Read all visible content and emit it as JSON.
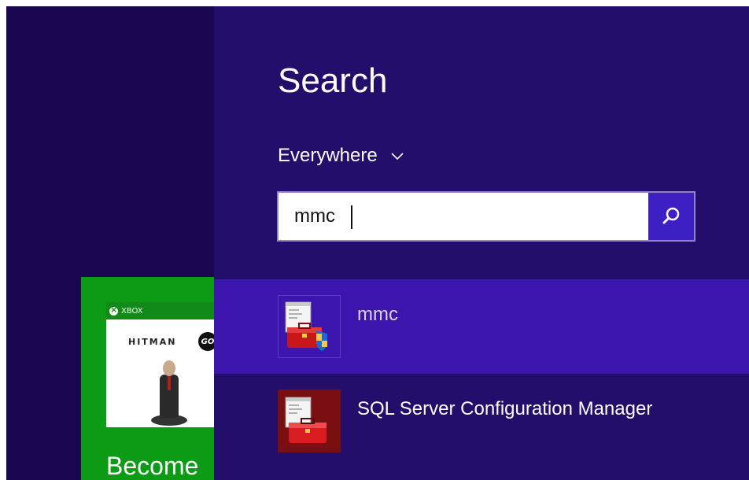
{
  "start_screen": {
    "tile": {
      "brand": "XBOX",
      "game_title": "HITMAN",
      "game_badge": "GO",
      "caption": "Become"
    }
  },
  "search": {
    "title": "Search",
    "scope_label": "Everywhere",
    "query": "mmc",
    "button_icon": "search-icon"
  },
  "results": [
    {
      "label": "mmc",
      "icon": "mmc-toolbox-shield-icon",
      "selected": true
    },
    {
      "label": "SQL Server Configuration Manager",
      "icon": "sql-config-toolbox-icon",
      "selected": false
    }
  ],
  "colors": {
    "start_background": "#1a0550",
    "search_pane": "#230e6b",
    "selected_result": "#3c14ae",
    "accent_button": "#3d1fc3",
    "tile_green": "#0c9b14"
  }
}
